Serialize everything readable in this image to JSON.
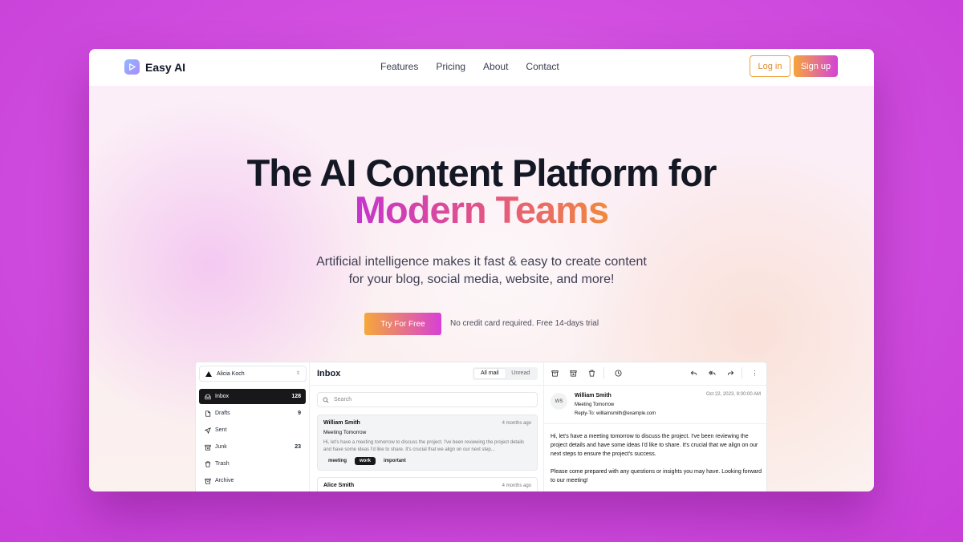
{
  "brand": {
    "name": "Easy AI"
  },
  "nav": {
    "links": [
      "Features",
      "Pricing",
      "About",
      "Contact"
    ],
    "login": "Log in",
    "signup": "Sign up"
  },
  "hero": {
    "title_line1": "The AI Content Platform for",
    "title_line2": "Modern Teams",
    "subtitle_line1": "Artificial intelligence makes it fast & easy to create content",
    "subtitle_line2": "for your blog, social media, website, and more!",
    "cta": "Try For Free",
    "cta_note": "No credit card required. Free 14-days trial"
  },
  "colors": {
    "accent_start": "#f5a83a",
    "accent_end": "#d740d6",
    "background": "#d24fe0"
  },
  "app": {
    "account": "Alicia Koch",
    "sidebar": [
      {
        "label": "Inbox",
        "count": "128",
        "icon": "inbox-icon"
      },
      {
        "label": "Drafts",
        "count": "9",
        "icon": "file-icon"
      },
      {
        "label": "Sent",
        "count": "",
        "icon": "send-icon"
      },
      {
        "label": "Junk",
        "count": "23",
        "icon": "archive-x-icon"
      },
      {
        "label": "Trash",
        "count": "",
        "icon": "trash-icon"
      },
      {
        "label": "Archive",
        "count": "",
        "icon": "archive-icon"
      }
    ],
    "inbox_title": "Inbox",
    "filters": [
      "All mail",
      "Unread"
    ],
    "search_placeholder": "Search",
    "mails": [
      {
        "from": "William Smith",
        "time": "4 months ago",
        "subject": "Meeting Tomorrow",
        "preview": "Hi, let's have a meeting tomorrow to discuss the project. I've been reviewing the project details and have some ideas I'd like to share. It's crucial that we align on our next step...",
        "tags": [
          "meeting",
          "work",
          "important"
        ]
      },
      {
        "from": "Alice Smith",
        "time": "4 months ago"
      }
    ],
    "reader": {
      "initials": "WS",
      "sender": "William Smith",
      "subject": "Meeting Tomorrow",
      "reply_to": "Reply-To: williamsmith@example.com",
      "date": "Oct 22, 2023, 9:00:00 AM",
      "body_p1": "Hi, let's have a meeting tomorrow to discuss the project. I've been reviewing the project details and have some ideas I'd like to share. It's crucial that we align on our next steps to ensure the project's success.",
      "body_p2": "Please come prepared with any questions or insights you may have. Looking forward to our meeting!"
    }
  }
}
